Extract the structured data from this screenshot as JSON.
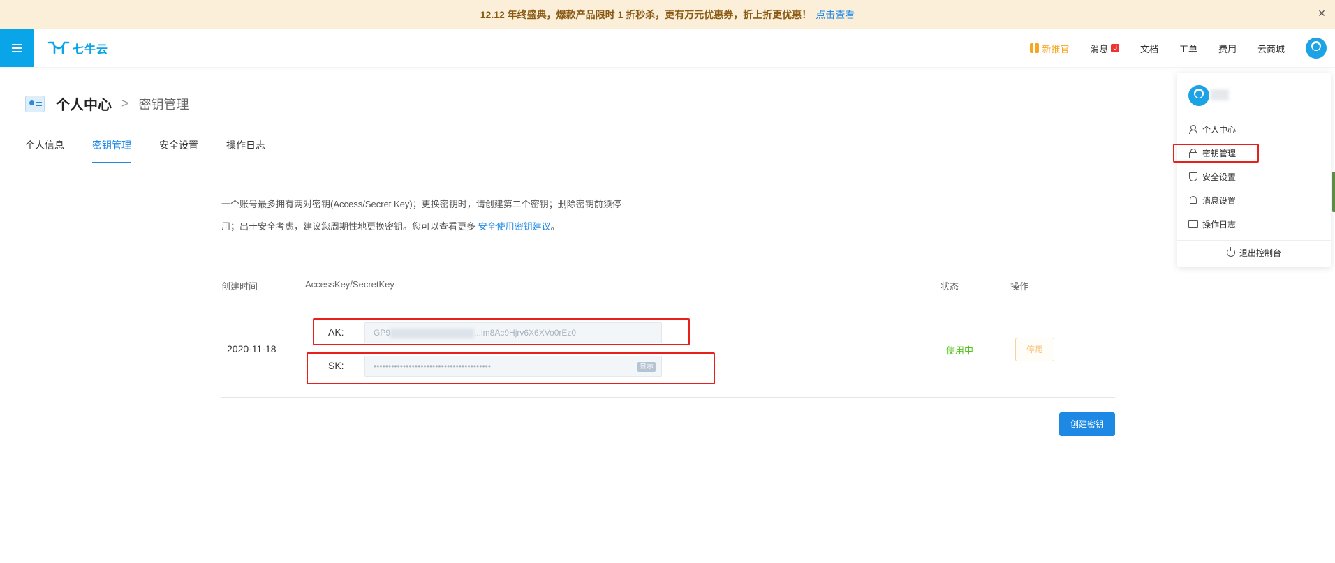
{
  "promo": {
    "text": "12.12 年终盛典，爆款产品限时 1 折秒杀，更有万元优惠券，折上折更优惠！",
    "link": "点击查看",
    "close": "×"
  },
  "nav": {
    "logo": "七牛云",
    "items": [
      {
        "label": "新推官",
        "icon": "gift-icon"
      },
      {
        "label": "消息",
        "badge": "3"
      },
      {
        "label": "文档"
      },
      {
        "label": "工单"
      },
      {
        "label": "费用"
      },
      {
        "label": "云商城"
      }
    ]
  },
  "breadcrumb": {
    "main": "个人中心",
    "sep": ">",
    "sub": "密钥管理"
  },
  "tabs": [
    "个人信息",
    "密钥管理",
    "安全设置",
    "操作日志"
  ],
  "notice": {
    "line1": "一个账号最多拥有两对密钥(Access/Secret Key)；更换密钥时，请创建第二个密钥；删除密钥前须停",
    "line2_prefix": "用；出于安全考虑，建议您周期性地更换密钥。您可以查看更多",
    "link": "安全使用密钥建议",
    "suffix": "。"
  },
  "table": {
    "headers": {
      "created": "创建时间",
      "keys": "AccessKey/SecretKey",
      "status": "状态",
      "ops": "操作"
    },
    "rows": [
      {
        "date": "2020-11-18",
        "ak_label": "AK:",
        "ak_prefix": "GP9",
        "ak_suffix": "...im8Ac9Hjrv6X6XVo0rEz0",
        "sk_label": "SK:",
        "sk_value": "••••••••••••••••••••••••••••••••••••••••",
        "show": "显示",
        "status": "使用中",
        "action": "停用"
      }
    ]
  },
  "create_button": "创建密钥",
  "dropdown": {
    "items": [
      {
        "label": "个人中心",
        "icon": "user-icon"
      },
      {
        "label": "密钥管理",
        "icon": "lock-icon"
      },
      {
        "label": "安全设置",
        "icon": "shield-icon"
      },
      {
        "label": "消息设置",
        "icon": "bell-icon"
      },
      {
        "label": "操作日志",
        "icon": "monitor-icon"
      }
    ],
    "logout": "退出控制台"
  },
  "colors": {
    "accent": "#1e88e5",
    "brand": "#0aa5e8",
    "success": "#52c41a",
    "highlight_box": "#e8201d"
  }
}
